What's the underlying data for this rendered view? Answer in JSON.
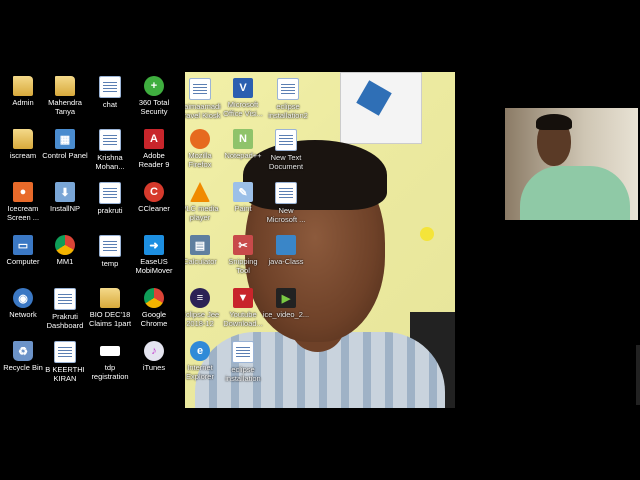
{
  "desktop": {
    "icons": [
      {
        "label": "Admin",
        "icon": "folder-icon",
        "color": "#d8a93b"
      },
      {
        "label": "Mahendra\nTanya",
        "icon": "folder-icon",
        "color": "#d8a93b"
      },
      {
        "label": "chat",
        "icon": "document-icon",
        "color": "#5b7fb3"
      },
      {
        "label": "360 Total\nSecurity",
        "icon": "shield-icon",
        "color": "#3fae3f"
      },
      {
        "label": "iscream",
        "icon": "folder-icon",
        "color": "#d8a93b"
      },
      {
        "label": "Control Panel",
        "icon": "control-panel-icon",
        "color": "#4a8ccf"
      },
      {
        "label": "Krishna\nMohan...",
        "icon": "document-icon",
        "color": "#5b7fb3"
      },
      {
        "label": "Adobe\nReader 9",
        "icon": "pdf-icon",
        "color": "#c8252b"
      },
      {
        "label": "Icecream\nScreen ...",
        "icon": "icecream-icon",
        "color": "#e86a2a"
      },
      {
        "label": "InstallNP",
        "icon": "installer-icon",
        "color": "#7aa6d6"
      },
      {
        "label": "prakruti",
        "icon": "document-icon",
        "color": "#5b7fb3"
      },
      {
        "label": "CCleaner",
        "icon": "ccleaner-icon",
        "color": "#d63a2c"
      },
      {
        "label": "Computer",
        "icon": "computer-icon",
        "color": "#3b78c4"
      },
      {
        "label": "MM1",
        "icon": "chrome-icon",
        "color": "#3aa757"
      },
      {
        "label": "temp",
        "icon": "document-icon",
        "color": "#5b7fb3"
      },
      {
        "label": "EaseUS\nMobiMover",
        "icon": "easeus-icon",
        "color": "#1d8fe1"
      },
      {
        "label": "Network",
        "icon": "network-icon",
        "color": "#3b78c4"
      },
      {
        "label": "Prakruti\nDashboard",
        "icon": "document-icon",
        "color": "#5b7fb3"
      },
      {
        "label": "BIO DEC'18\nClaims 1part",
        "icon": "folder-icon",
        "color": "#d8a93b"
      },
      {
        "label": "Google\nChrome",
        "icon": "chrome-icon",
        "color": "#3aa757"
      },
      {
        "label": "Recycle Bin",
        "icon": "recycle-bin-icon",
        "color": "#6c93c8"
      },
      {
        "label": "B KEERTHI\nKIRAN",
        "icon": "document-icon",
        "color": "#5b7fb3"
      },
      {
        "label": "tdp\nregistration",
        "icon": "blank-file-icon",
        "color": "#ffffff"
      },
      {
        "label": "iTunes",
        "icon": "itunes-icon",
        "color": "#d8d8e8"
      }
    ],
    "overlay_icons": [
      {
        "label": "Kaimaamadi\nTravel Kiosk",
        "icon": "shortcut-icon"
      },
      {
        "label": "Microsoft\nOffice Visi...",
        "icon": "office-icon"
      },
      {
        "label": "eclipse\ninstallation2",
        "icon": "document-icon"
      },
      {
        "label": "Mozilla\nFirefox",
        "icon": "firefox-icon"
      },
      {
        "label": "Notepad++",
        "icon": "notepad-icon"
      },
      {
        "label": "New Text\nDocument",
        "icon": "text-document-icon"
      },
      {
        "label": "VLC media\nplayer",
        "icon": "vlc-icon"
      },
      {
        "label": "Paint",
        "icon": "paint-icon"
      },
      {
        "label": "New\nMicrosoft ...",
        "icon": "document-icon"
      },
      {
        "label": "Calculator",
        "icon": "calculator-icon"
      },
      {
        "label": "Snipping\nTool",
        "icon": "snipping-tool-icon"
      },
      {
        "label": "java-Class",
        "icon": "folder-icon"
      },
      {
        "label": "Eclipse Jee\n2018-12",
        "icon": "eclipse-icon"
      },
      {
        "label": "Youtube\nDownload...",
        "icon": "youtube-downloader-icon"
      },
      {
        "label": "ice_video_2...",
        "icon": "video-file-icon"
      },
      {
        "label": "Internet\nExplorer",
        "icon": "internet-explorer-icon"
      },
      {
        "label": "eclipse\ninstallation",
        "icon": "document-icon"
      }
    ]
  }
}
